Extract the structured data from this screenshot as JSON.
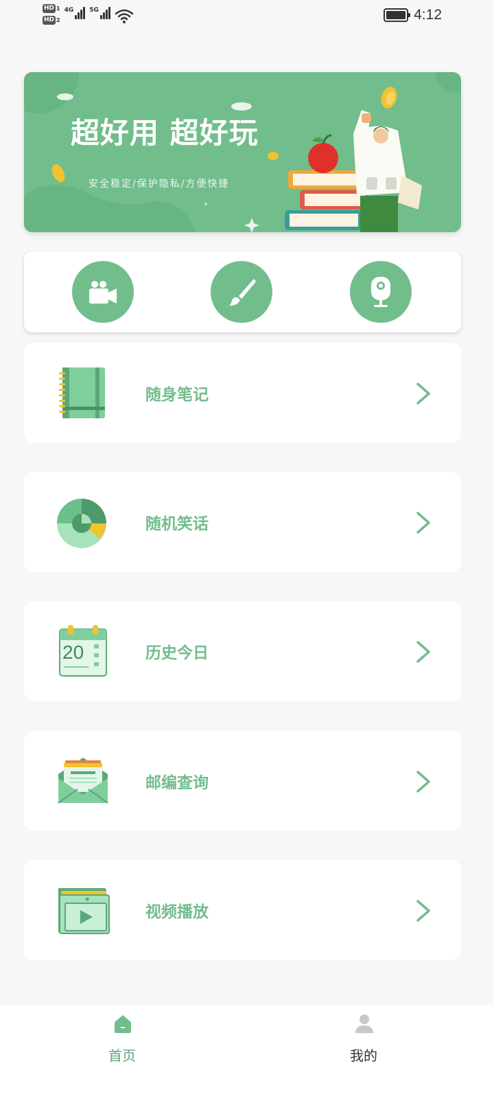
{
  "status_bar": {
    "sim1_badge": "HD",
    "sim1_num": "1",
    "sim2_badge": "HD",
    "sim2_num": "2",
    "network1": "4G",
    "network2": "5G",
    "time": "4:12",
    "battery_level": 1.0,
    "icons": [
      "signal-icon",
      "wifi-icon",
      "battery-icon"
    ]
  },
  "banner": {
    "title": "超好用 超好玩",
    "subtitle": "安全稳定/保护隐私/方便快捷"
  },
  "quick_actions": [
    {
      "icon": "video-camera-icon"
    },
    {
      "icon": "brush-icon"
    },
    {
      "icon": "webcam-icon"
    }
  ],
  "menu": [
    {
      "label": "随身笔记",
      "icon": "notebook-icon"
    },
    {
      "label": "随机笑话",
      "icon": "pie-chart-icon"
    },
    {
      "label": "历史今日",
      "icon": "calendar-icon",
      "icon_text": "20"
    },
    {
      "label": "邮编查询",
      "icon": "mail-envelope-icon"
    },
    {
      "label": "视频播放",
      "icon": "video-folder-icon"
    }
  ],
  "tabbar": {
    "home_label": "首页",
    "mine_label": "我的",
    "active": "home"
  },
  "colors": {
    "accent": "#72bd8c",
    "background": "#f7f7f7",
    "card": "#ffffff",
    "active_tab_text": "#5aa877",
    "inactive_tab_text": "#333333"
  }
}
